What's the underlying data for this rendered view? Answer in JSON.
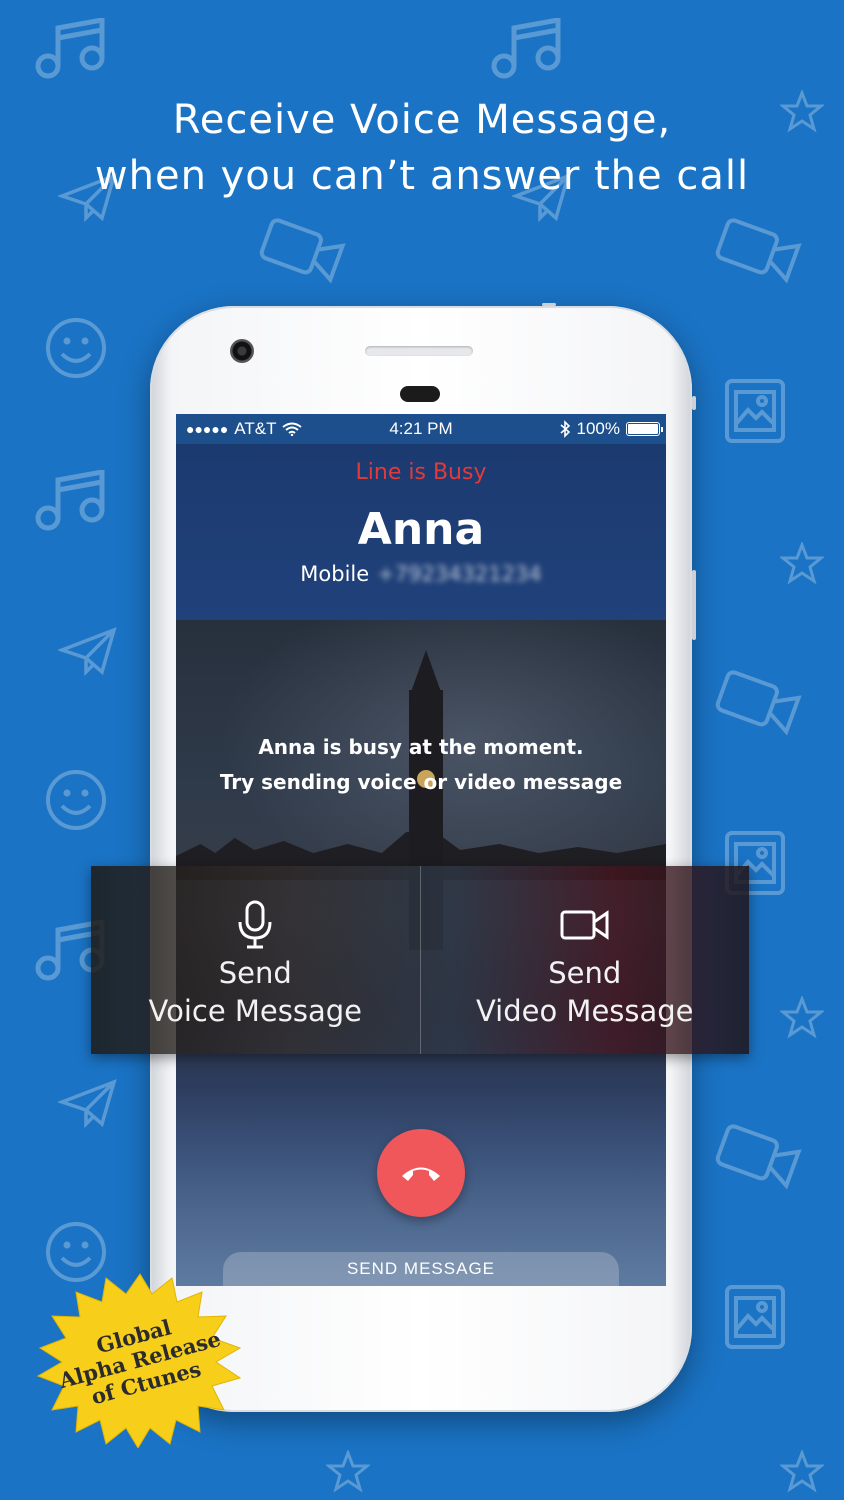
{
  "headline": {
    "line1": "Receive Voice Message,",
    "line2": "when you can’t answer the call"
  },
  "statusbar": {
    "signal_dots": "●●●●●",
    "carrier": "AT&T",
    "time": "4:21 PM",
    "battery_percent": "100%",
    "battery_level": 1.0
  },
  "call": {
    "status": "Line is Busy",
    "caller_name": "Anna",
    "number_type": "Mobile",
    "number_obscured": "+79234321234",
    "message_line1": "Anna is busy at the moment.",
    "message_line2": "Try sending voice or video message"
  },
  "actions": {
    "voice": {
      "line1": "Send",
      "line2": "Voice Message",
      "icon": "microphone-icon"
    },
    "video": {
      "line1": "Send",
      "line2": "Video Message",
      "icon": "video-camera-icon"
    }
  },
  "hangup_icon": "end-call-icon",
  "send_message_label": "SEND MESSAGE",
  "badge": {
    "line1": "Global",
    "line2": "Alpha Release",
    "line3": "of Ctunes"
  },
  "colors": {
    "background": "#1a73c4",
    "busy_text": "#e23a3a",
    "hangup": "#f0575a",
    "badge": "#f7cf1b"
  }
}
